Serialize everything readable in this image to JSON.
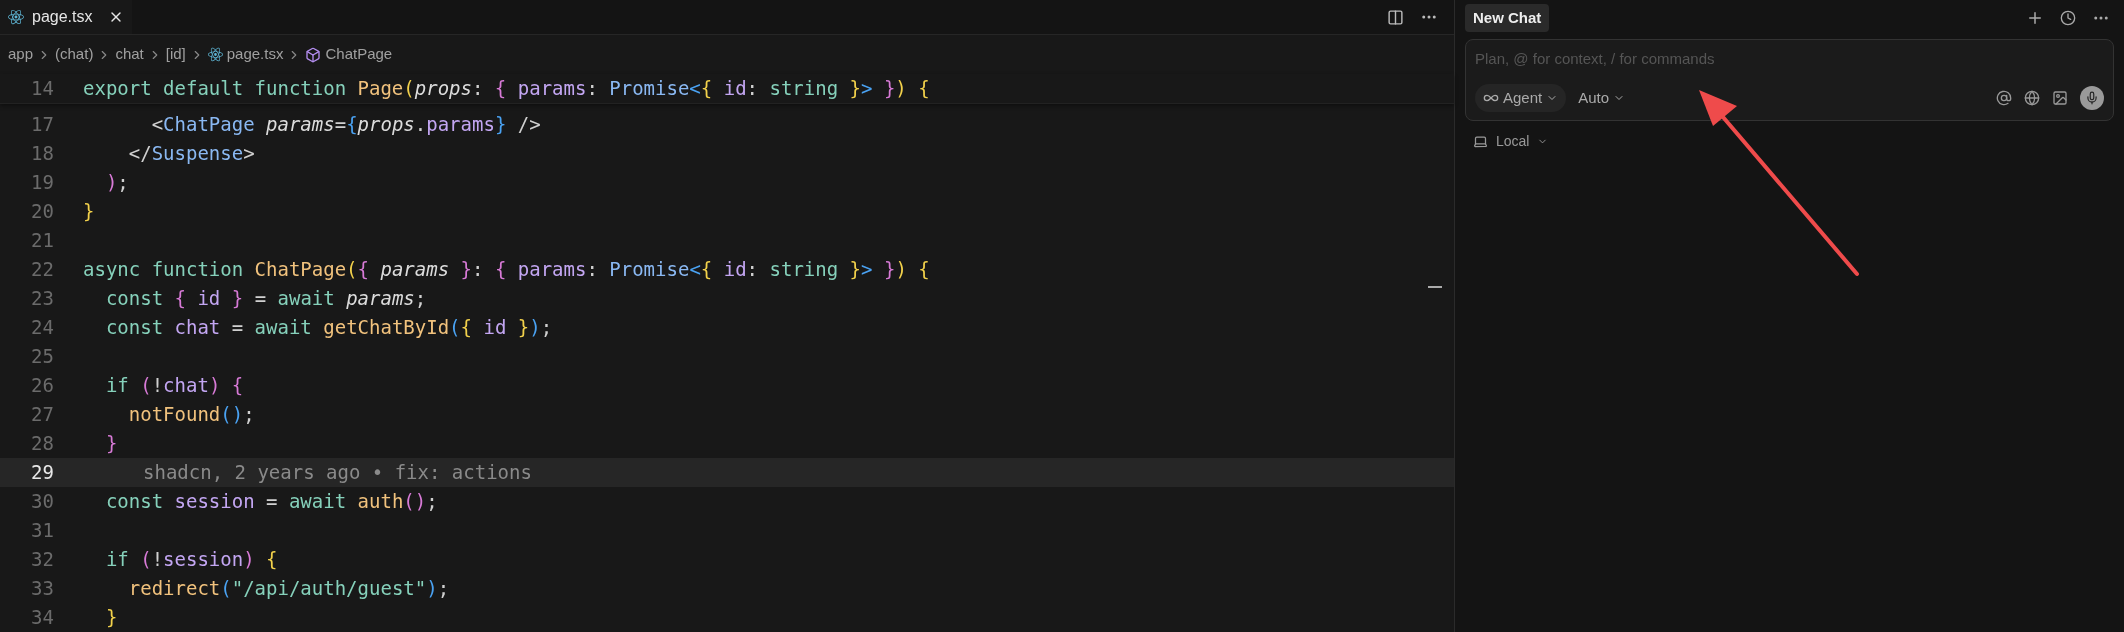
{
  "editor": {
    "tabs": [
      {
        "label": "page.tsx",
        "selected": true
      }
    ],
    "breadcrumbs": [
      {
        "label": "app",
        "kind": "folder"
      },
      {
        "label": "(chat)",
        "kind": "folder"
      },
      {
        "label": "chat",
        "kind": "folder"
      },
      {
        "label": "[id]",
        "kind": "folder"
      },
      {
        "label": "page.tsx",
        "kind": "file"
      },
      {
        "label": "ChatPage",
        "kind": "symbol"
      }
    ],
    "sticky_line": {
      "number": "14",
      "tokens": [
        {
          "text": "export default function ",
          "kind": "kw"
        },
        {
          "text": "Page",
          "kind": "fn"
        },
        {
          "text": "(",
          "kind": "p1"
        },
        {
          "text": "props",
          "kind": "param"
        },
        {
          "text": ": ",
          "kind": "text"
        },
        {
          "text": "{",
          "kind": "p2"
        },
        {
          "text": " params",
          "kind": "prop"
        },
        {
          "text": ": ",
          "kind": "text"
        },
        {
          "text": "Promise",
          "kind": "type"
        },
        {
          "text": "<",
          "kind": "p3"
        },
        {
          "text": "{",
          "kind": "p1"
        },
        {
          "text": " id",
          "kind": "prop"
        },
        {
          "text": ": ",
          "kind": "text"
        },
        {
          "text": "string",
          "kind": "kw"
        },
        {
          "text": " }",
          "kind": "p1"
        },
        {
          "text": ">",
          "kind": "p3"
        },
        {
          "text": " }",
          "kind": "p2"
        },
        {
          "text": ")",
          "kind": "p1"
        },
        {
          "text": " {",
          "kind": "p1"
        }
      ]
    },
    "lines": [
      {
        "number": "17",
        "current": false,
        "tokens": [
          {
            "text": "      <",
            "kind": "text"
          },
          {
            "text": "ChatPage",
            "kind": "type"
          },
          {
            "text": " params",
            "kind": "param"
          },
          {
            "text": "=",
            "kind": "text"
          },
          {
            "text": "{",
            "kind": "p3"
          },
          {
            "text": "props",
            "kind": "param"
          },
          {
            "text": ".",
            "kind": "text"
          },
          {
            "text": "params",
            "kind": "prop"
          },
          {
            "text": "}",
            "kind": "p3"
          },
          {
            "text": " />",
            "kind": "text"
          }
        ]
      },
      {
        "number": "18",
        "current": false,
        "tokens": [
          {
            "text": "    </",
            "kind": "text"
          },
          {
            "text": "Suspense",
            "kind": "type"
          },
          {
            "text": ">",
            "kind": "text"
          }
        ]
      },
      {
        "number": "19",
        "current": false,
        "tokens": [
          {
            "text": "  )",
            "kind": "p2"
          },
          {
            "text": ";",
            "kind": "text"
          }
        ]
      },
      {
        "number": "20",
        "current": false,
        "tokens": [
          {
            "text": "}",
            "kind": "p1"
          }
        ]
      },
      {
        "number": "21",
        "current": false
      },
      {
        "number": "22",
        "current": false,
        "tokens": [
          {
            "text": "async function ",
            "kind": "kw"
          },
          {
            "text": "ChatPage",
            "kind": "fn"
          },
          {
            "text": "(",
            "kind": "p1"
          },
          {
            "text": "{",
            "kind": "p2"
          },
          {
            "text": " params ",
            "kind": "param"
          },
          {
            "text": "}",
            "kind": "p2"
          },
          {
            "text": ": ",
            "kind": "text"
          },
          {
            "text": "{",
            "kind": "p2"
          },
          {
            "text": " params",
            "kind": "prop"
          },
          {
            "text": ": ",
            "kind": "text"
          },
          {
            "text": "Promise",
            "kind": "type"
          },
          {
            "text": "<",
            "kind": "p3"
          },
          {
            "text": "{",
            "kind": "p1"
          },
          {
            "text": " id",
            "kind": "prop"
          },
          {
            "text": ": ",
            "kind": "text"
          },
          {
            "text": "string",
            "kind": "kw"
          },
          {
            "text": " }",
            "kind": "p1"
          },
          {
            "text": ">",
            "kind": "p3"
          },
          {
            "text": " }",
            "kind": "p2"
          },
          {
            "text": ")",
            "kind": "p1"
          },
          {
            "text": " {",
            "kind": "p1"
          }
        ]
      },
      {
        "number": "23",
        "current": false,
        "tokens": [
          {
            "text": "  const ",
            "kind": "kw"
          },
          {
            "text": "{",
            "kind": "p2"
          },
          {
            "text": " id ",
            "kind": "prop"
          },
          {
            "text": "}",
            "kind": "p2"
          },
          {
            "text": " = ",
            "kind": "text"
          },
          {
            "text": "await ",
            "kind": "kw"
          },
          {
            "text": "params",
            "kind": "param"
          },
          {
            "text": ";",
            "kind": "text"
          }
        ]
      },
      {
        "number": "24",
        "current": false,
        "tokens": [
          {
            "text": "  const ",
            "kind": "kw"
          },
          {
            "text": "chat",
            "kind": "prop"
          },
          {
            "text": " = ",
            "kind": "text"
          },
          {
            "text": "await ",
            "kind": "kw"
          },
          {
            "text": "getChatById",
            "kind": "fn"
          },
          {
            "text": "(",
            "kind": "p3"
          },
          {
            "text": "{",
            "kind": "p1"
          },
          {
            "text": " id ",
            "kind": "prop"
          },
          {
            "text": "}",
            "kind": "p1"
          },
          {
            "text": ")",
            "kind": "p3"
          },
          {
            "text": ";",
            "kind": "text"
          }
        ]
      },
      {
        "number": "25",
        "current": false
      },
      {
        "number": "26",
        "current": false,
        "tokens": [
          {
            "text": "  if ",
            "kind": "kw"
          },
          {
            "text": "(",
            "kind": "p2"
          },
          {
            "text": "!",
            "kind": "text"
          },
          {
            "text": "chat",
            "kind": "prop"
          },
          {
            "text": ")",
            "kind": "p2"
          },
          {
            "text": " {",
            "kind": "p2"
          }
        ]
      },
      {
        "number": "27",
        "current": false,
        "tokens": [
          {
            "text": "    notFound",
            "kind": "fn"
          },
          {
            "text": "()",
            "kind": "p3"
          },
          {
            "text": ";",
            "kind": "text"
          }
        ]
      },
      {
        "number": "28",
        "current": false,
        "tokens": [
          {
            "text": "  }",
            "kind": "p2"
          }
        ]
      },
      {
        "number": "29",
        "current": true,
        "blame": "shadcn, 2 years ago • fix: actions"
      },
      {
        "number": "30",
        "current": false,
        "tokens": [
          {
            "text": "  const ",
            "kind": "kw"
          },
          {
            "text": "session",
            "kind": "prop"
          },
          {
            "text": " = ",
            "kind": "text"
          },
          {
            "text": "await ",
            "kind": "kw"
          },
          {
            "text": "auth",
            "kind": "fn"
          },
          {
            "text": "()",
            "kind": "p2"
          },
          {
            "text": ";",
            "kind": "text"
          }
        ]
      },
      {
        "number": "31",
        "current": false
      },
      {
        "number": "32",
        "current": false,
        "tokens": [
          {
            "text": "  if ",
            "kind": "kw"
          },
          {
            "text": "(",
            "kind": "p2"
          },
          {
            "text": "!",
            "kind": "text"
          },
          {
            "text": "session",
            "kind": "prop"
          },
          {
            "text": ")",
            "kind": "p2"
          },
          {
            "text": " {",
            "kind": "p1"
          }
        ]
      },
      {
        "number": "33",
        "current": false,
        "tokens": [
          {
            "text": "    redirect",
            "kind": "fn"
          },
          {
            "text": "(",
            "kind": "p3"
          },
          {
            "text": "\"/api/auth/guest\"",
            "kind": "str"
          },
          {
            "text": ")",
            "kind": "p3"
          },
          {
            "text": ";",
            "kind": "text"
          }
        ]
      },
      {
        "number": "34",
        "current": false,
        "tokens": [
          {
            "text": "  }",
            "kind": "p1"
          }
        ]
      }
    ]
  },
  "chat_panel": {
    "tabs": [
      {
        "label": "New Chat",
        "selected": true
      }
    ],
    "input": {
      "placeholder": "Plan, @ for context, / for commands"
    },
    "mode": "Agent",
    "model": "Auto",
    "environment": "Local"
  }
}
